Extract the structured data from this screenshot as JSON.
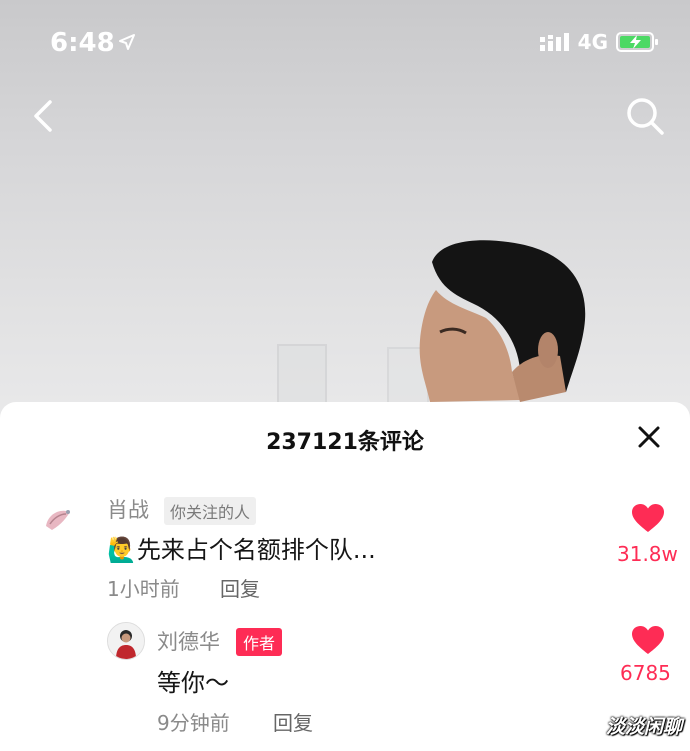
{
  "status_bar": {
    "time": "6:48",
    "network": "4G",
    "icons": [
      "location-arrow-icon",
      "signal-icon",
      "battery-charging-icon"
    ]
  },
  "nav": {
    "back_icon": "chevron-left-icon",
    "search_icon": "search-icon"
  },
  "comments_sheet": {
    "title": "237121条评论",
    "close_icon": "close-icon",
    "comments": [
      {
        "user": "肖战",
        "tag": "你关注的人",
        "text": "🙋‍♂️先来占个名额排个队...",
        "time": "1小时前",
        "reply_label": "回复",
        "likes": "31.8w",
        "replies": [
          {
            "user": "刘德华",
            "tag": "作者",
            "text": "等你～",
            "time": "9分钟前",
            "reply_label": "回复",
            "likes": "6785"
          }
        ]
      }
    ]
  },
  "watermark": "淡淡闲聊",
  "colors": {
    "accent": "#fe2c55",
    "battery": "#4cd964",
    "sheet_bg": "#ffffff"
  }
}
